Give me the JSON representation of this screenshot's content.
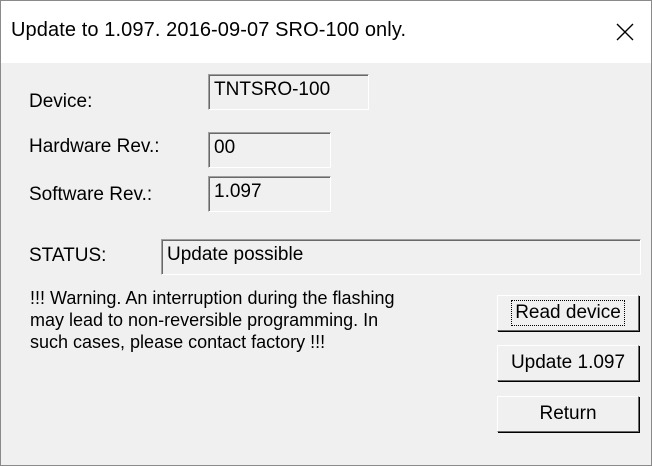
{
  "window": {
    "title": "Update to 1.097. 2016-09-07 SRO-100 only.",
    "close_icon": "close-icon"
  },
  "device_info": {
    "device_label": "Device:",
    "device_value": "TNTSRO-100",
    "hardware_label": "Hardware Rev.:",
    "hardware_value": "00",
    "software_label": "Software Rev.:",
    "software_value": "1.097"
  },
  "status": {
    "label": "STATUS:",
    "value": "Update possible"
  },
  "warning": {
    "line1": "!!! Warning. An interruption during the flashing",
    "line2": "may lead to non-reversible programming. In",
    "line3": "such cases, please contact factory !!!"
  },
  "buttons": {
    "read_device": "Read device",
    "update": "Update 1.097",
    "return": "Return"
  }
}
